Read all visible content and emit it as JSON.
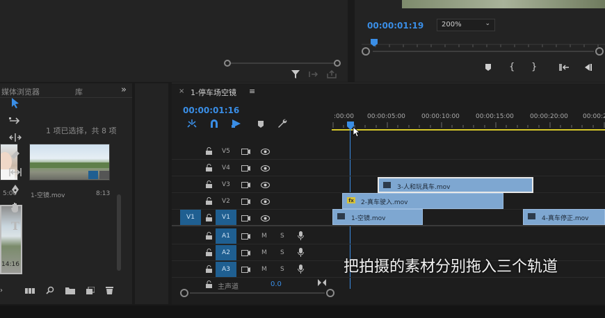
{
  "program_monitor": {
    "timecode": "00:00:01:19",
    "zoom": "200%",
    "controls": [
      "marker-icon",
      "in-point-icon",
      "out-point-icon",
      "go-to-in-icon",
      "step-back-icon"
    ]
  },
  "project_panel": {
    "tabs": [
      {
        "label": "媒体浏览器"
      },
      {
        "label": "库"
      }
    ],
    "more": "»",
    "selection_status": "1 项已选择，共 8 项",
    "items": [
      {
        "name": "",
        "duration": "5:00"
      },
      {
        "name": "1-空镜.mov",
        "duration": "8:13"
      },
      {
        "name": "",
        "duration": "14:16"
      }
    ]
  },
  "timeline": {
    "close": "×",
    "sequence_name": "1-停车场空镜",
    "menu": "≡",
    "timecode": "00:00:01:16",
    "ruler_labels": [
      ":00:00",
      "00:00:05:00",
      "00:00:10:00",
      "00:00:15:00",
      "00:00:20:00",
      "00:00:2"
    ],
    "video_tracks": [
      {
        "name": "V5"
      },
      {
        "name": "V4"
      },
      {
        "name": "V3"
      },
      {
        "name": "V2"
      },
      {
        "name": "V1",
        "source": "V1"
      }
    ],
    "audio_tracks": [
      {
        "name": "A1",
        "m": "M",
        "s": "S"
      },
      {
        "name": "A2",
        "m": "M",
        "s": "S"
      },
      {
        "name": "A3",
        "m": "M",
        "s": "S"
      }
    ],
    "master": {
      "label": "主声道",
      "value": "0.0"
    },
    "clips": {
      "v3": "3-人和玩具车.mov",
      "v2": "2-真车驶入.mov",
      "v1a": "1-空镜.mov",
      "v1b": "4-真车停正.mov"
    },
    "fx_badge": "fx"
  },
  "subtitle": "把拍摄的素材分别拖入三个轨道"
}
